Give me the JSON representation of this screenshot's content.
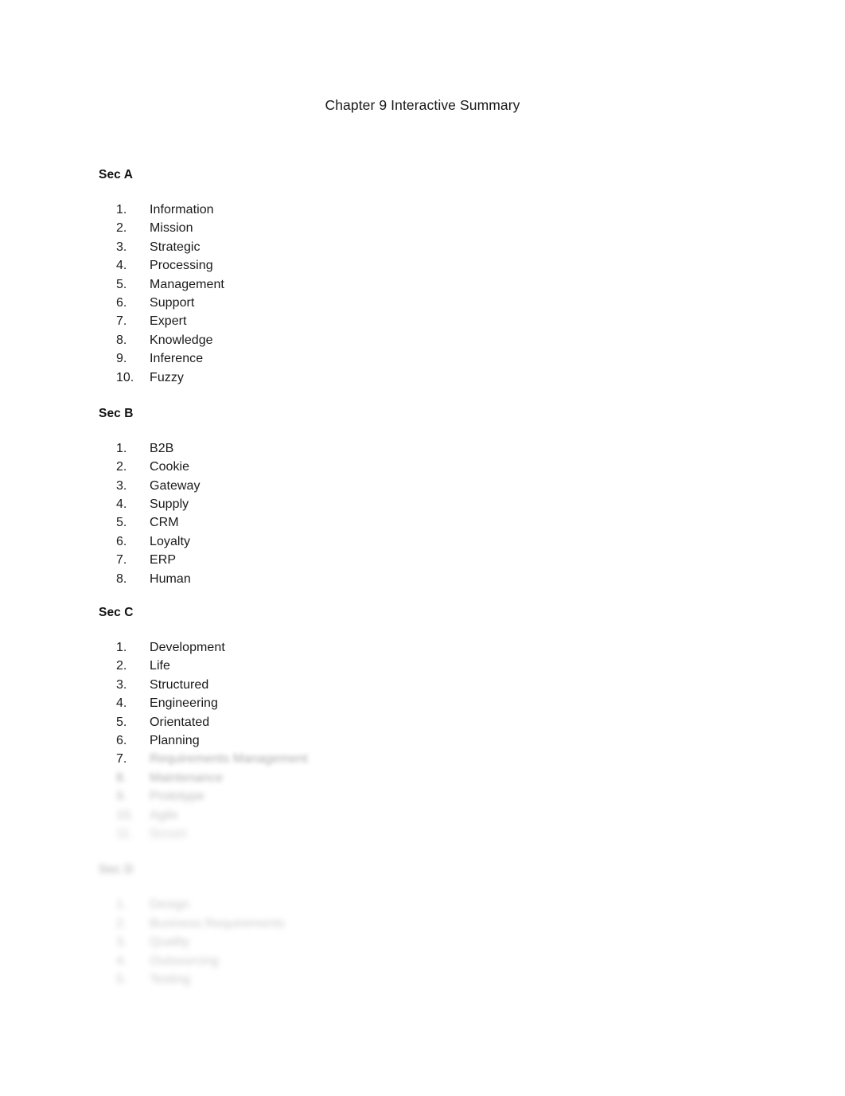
{
  "document": {
    "title": "Chapter 9 Interactive Summary",
    "background_color": "#ffffff",
    "text_color": "#1a1a1a",
    "obscured_text_color": "#8f8f8f"
  },
  "sections": [
    {
      "heading": "Sec A",
      "legible": true,
      "items": [
        {
          "marker": "1.",
          "text": "Information",
          "blurred": false
        },
        {
          "marker": "2.",
          "text": "Mission",
          "blurred": false
        },
        {
          "marker": "3.",
          "text": "Strategic",
          "blurred": false
        },
        {
          "marker": "4.",
          "text": "Processing",
          "blurred": false
        },
        {
          "marker": "5.",
          "text": "Management",
          "blurred": false
        },
        {
          "marker": "6.",
          "text": "Support",
          "blurred": false
        },
        {
          "marker": "7.",
          "text": "Expert",
          "blurred": false
        },
        {
          "marker": "8.",
          "text": "Knowledge",
          "blurred": false
        },
        {
          "marker": "9.",
          "text": "Inference",
          "blurred": false
        },
        {
          "marker": "10.",
          "text": "Fuzzy",
          "blurred": false
        }
      ]
    },
    {
      "heading": "Sec B",
      "legible": true,
      "items": [
        {
          "marker": "1.",
          "text": "B2B",
          "blurred": false
        },
        {
          "marker": "2.",
          "text": "Cookie",
          "blurred": false
        },
        {
          "marker": "3.",
          "text": "Gateway",
          "blurred": false
        },
        {
          "marker": "4.",
          "text": "Supply",
          "blurred": false
        },
        {
          "marker": "5.",
          "text": "CRM",
          "blurred": false
        },
        {
          "marker": "6.",
          "text": "Loyalty",
          "blurred": false
        },
        {
          "marker": "7.",
          "text": "ERP",
          "blurred": false
        },
        {
          "marker": "8.",
          "text": "Human",
          "blurred": false
        }
      ]
    },
    {
      "heading": "Sec C",
      "legible": true,
      "items": [
        {
          "marker": "1.",
          "text": "Development",
          "blurred": false
        },
        {
          "marker": "2.",
          "text": "Life",
          "blurred": false
        },
        {
          "marker": "3.",
          "text": "Structured",
          "blurred": false
        },
        {
          "marker": "4.",
          "text": "Engineering",
          "blurred": false
        },
        {
          "marker": "5.",
          "text": "Orientated",
          "blurred": false
        },
        {
          "marker": "6.",
          "text": "Planning",
          "blurred": false
        },
        {
          "marker": "7.",
          "text": "Requirements Management",
          "blurred": true,
          "marker_legible": true
        },
        {
          "marker": "8.",
          "text": "Maintenance",
          "blurred": true
        },
        {
          "marker": "9.",
          "text": "Prototype",
          "blurred": true
        },
        {
          "marker": "10.",
          "text": "Agile",
          "blurred": true
        },
        {
          "marker": "11.",
          "text": "Scrum",
          "blurred": true
        }
      ]
    },
    {
      "heading": "Sec D",
      "legible": false,
      "items": [
        {
          "marker": "1.",
          "text": "Design",
          "blurred": true
        },
        {
          "marker": "2.",
          "text": "Business Requirements",
          "blurred": true
        },
        {
          "marker": "3.",
          "text": "Quality",
          "blurred": true
        },
        {
          "marker": "4.",
          "text": "Outsourcing",
          "blurred": true
        },
        {
          "marker": "5.",
          "text": "Testing",
          "blurred": true
        }
      ]
    }
  ]
}
